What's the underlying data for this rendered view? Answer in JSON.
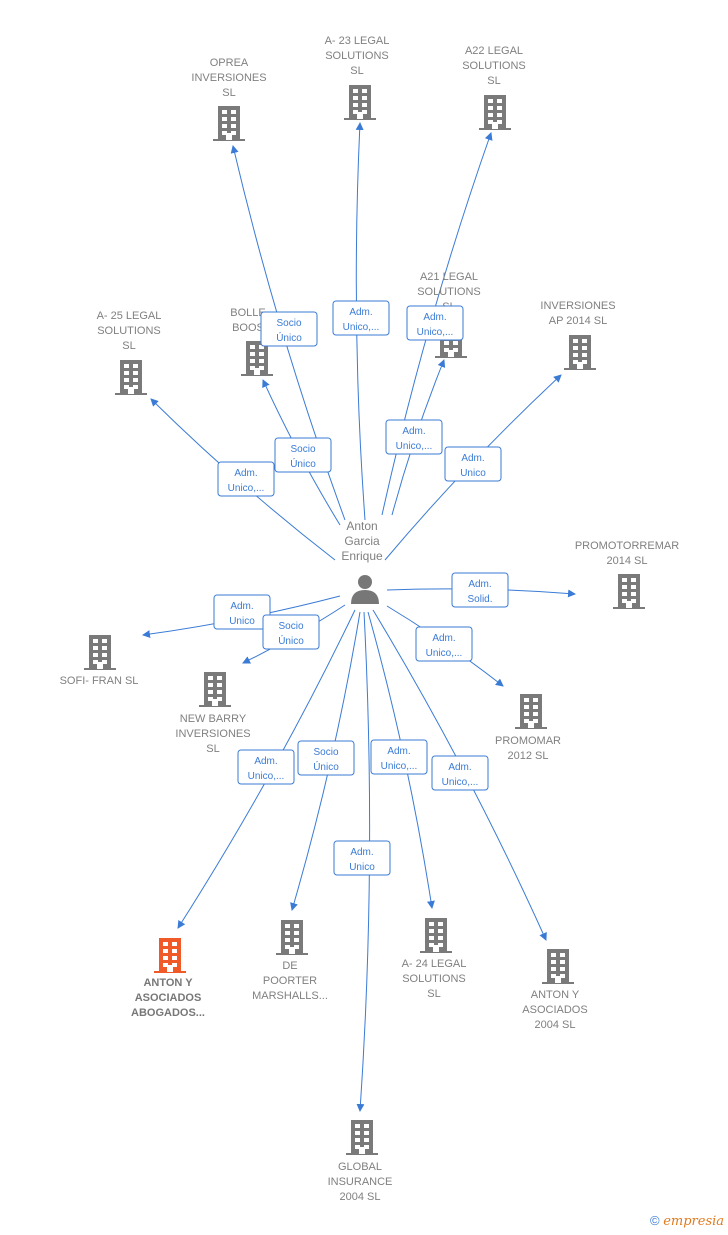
{
  "center": {
    "id": "anton",
    "label": [
      "Anton",
      "Garcia",
      "Enrique"
    ],
    "icon": "person-icon"
  },
  "nodes": [
    {
      "id": "oprea",
      "label": [
        "OPREA",
        "INVERSIONES",
        "SL"
      ]
    },
    {
      "id": "a23",
      "label": [
        "A- 23 LEGAL",
        "SOLUTIONS",
        "SL"
      ]
    },
    {
      "id": "a22",
      "label": [
        "A22 LEGAL",
        "SOLUTIONS",
        "SL"
      ]
    },
    {
      "id": "a25",
      "label": [
        "A- 25 LEGAL",
        "SOLUTIONS",
        "SL"
      ]
    },
    {
      "id": "bolle",
      "label": [
        "BOLLE",
        "BOOS"
      ]
    },
    {
      "id": "a21",
      "label": [
        "A21 LEGAL",
        "SOLUTIONS",
        "SL"
      ]
    },
    {
      "id": "invap",
      "label": [
        "INVERSIONES",
        "AP 2014  SL"
      ]
    },
    {
      "id": "promotorremar",
      "label": [
        "PROMOTORREMAR",
        "2014  SL"
      ]
    },
    {
      "id": "sofi",
      "label": [
        "SOFI- FRAN  SL"
      ]
    },
    {
      "id": "newbarry",
      "label": [
        "NEW BARRY",
        "INVERSIONES",
        "SL"
      ]
    },
    {
      "id": "promomar",
      "label": [
        "PROMOMAR",
        "2012 SL"
      ]
    },
    {
      "id": "abogados",
      "label": [
        "ANTON Y",
        "ASOCIADOS",
        "ABOGADOS..."
      ],
      "highlight": true
    },
    {
      "id": "depoorter",
      "label": [
        "DE",
        "POORTER",
        "MARSHALLS..."
      ]
    },
    {
      "id": "a24",
      "label": [
        "A- 24 LEGAL",
        "SOLUTIONS",
        "SL"
      ]
    },
    {
      "id": "anton2004",
      "label": [
        "ANTON Y",
        "ASOCIADOS",
        "2004  SL"
      ]
    },
    {
      "id": "global",
      "label": [
        "GLOBAL",
        "INSURANCE",
        "2004  SL"
      ]
    }
  ],
  "edges": [
    {
      "to": "oprea",
      "label": [
        "Socio",
        "Único"
      ]
    },
    {
      "to": "a23",
      "label": [
        "Adm.",
        "Unico,..."
      ]
    },
    {
      "to": "a22",
      "label": [
        "Adm.",
        "Unico,..."
      ]
    },
    {
      "to": "a21",
      "label": [
        "Adm.",
        "Unico,..."
      ]
    },
    {
      "to": "a25",
      "label": [
        "Adm.",
        "Unico,..."
      ]
    },
    {
      "to": "bolle",
      "label": [
        "Socio",
        "Único"
      ]
    },
    {
      "to": "invap",
      "label": [
        "Adm.",
        "Unico"
      ]
    },
    {
      "to": "promotorremar",
      "label": [
        "Adm.",
        "Solid."
      ]
    },
    {
      "to": "sofi",
      "label": [
        "Adm.",
        "Unico"
      ]
    },
    {
      "to": "newbarry",
      "label": [
        "Socio",
        "Único"
      ]
    },
    {
      "to": "promomar",
      "label": [
        "Adm.",
        "Unico,..."
      ]
    },
    {
      "to": "abogados",
      "label": [
        "Adm.",
        "Unico,..."
      ]
    },
    {
      "to": "depoorter",
      "label": [
        "Socio",
        "Único"
      ]
    },
    {
      "to": "global",
      "label": [
        "Adm.",
        "Unico"
      ]
    },
    {
      "to": "a24",
      "label": [
        "Adm.",
        "Unico,..."
      ]
    },
    {
      "to": "anton2004",
      "label": [
        "Adm.",
        "Unico,..."
      ]
    }
  ],
  "colors": {
    "edge": "#3a7bd5",
    "building": "#7a7a7a",
    "highlight": "#f05a28"
  },
  "footer": {
    "copyright": "©",
    "brand": "empresia"
  }
}
